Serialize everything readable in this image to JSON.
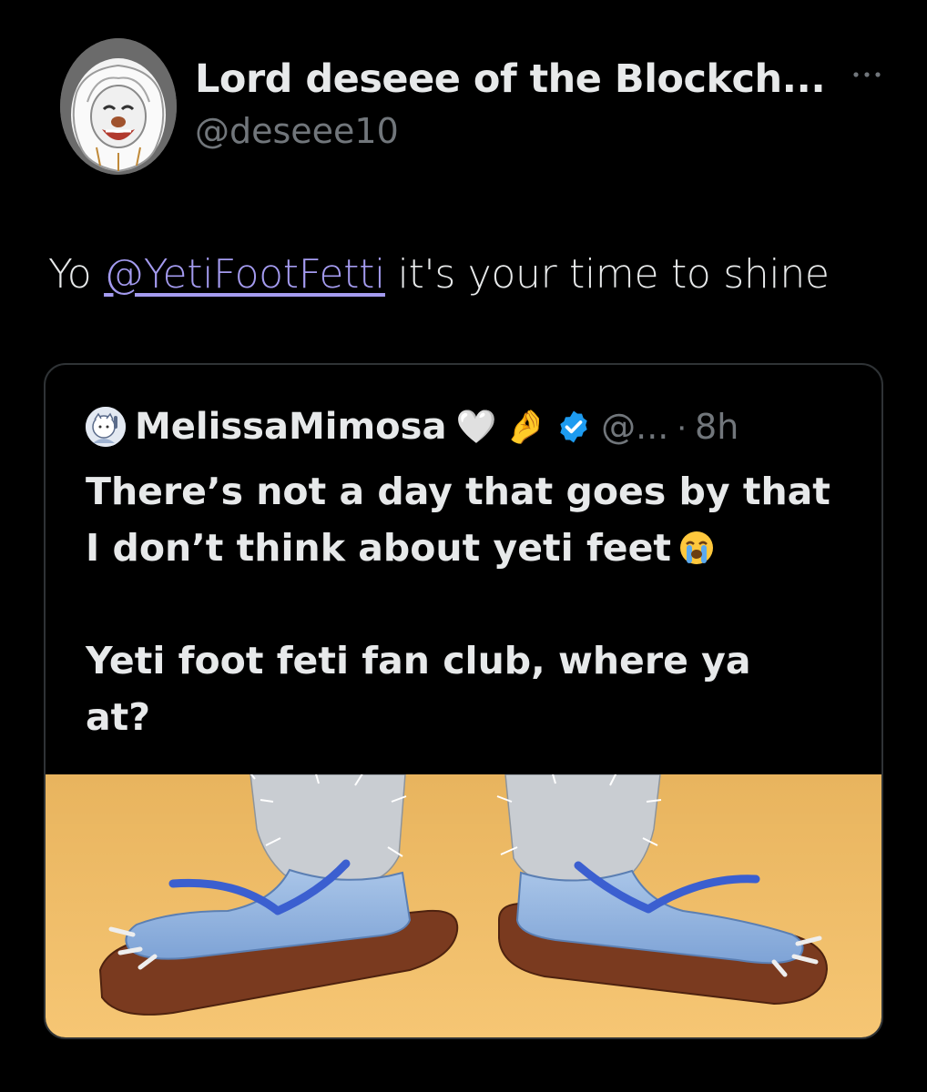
{
  "tweet": {
    "author_name": "Lord deseee of the Blockch...",
    "author_handle": "@deseee10",
    "text_prefix": "Yo ",
    "mention": "@YetiFootFetti",
    "text_suffix": " it's your time to shine"
  },
  "quote": {
    "author_name": "MelissaMimosa",
    "name_emojis": [
      "🤍",
      "🤌"
    ],
    "verified": true,
    "author_handle": "@...",
    "separator": "·",
    "time": "8h",
    "line1": "There’s not a day that goes by that",
    "line2": "I don’t think about yeti feet",
    "line2_emoji": "loudly-crying-face",
    "line3": "Yeti foot feti fan club, where ya",
    "line4": "at?"
  },
  "colors": {
    "background": "#000000",
    "mention": "#a49bf0",
    "verified": "#1d9bf0",
    "media_background": "#f4c26c"
  },
  "icons": {
    "more": "more-horizontal-icon",
    "verified": "verified-badge-icon"
  }
}
